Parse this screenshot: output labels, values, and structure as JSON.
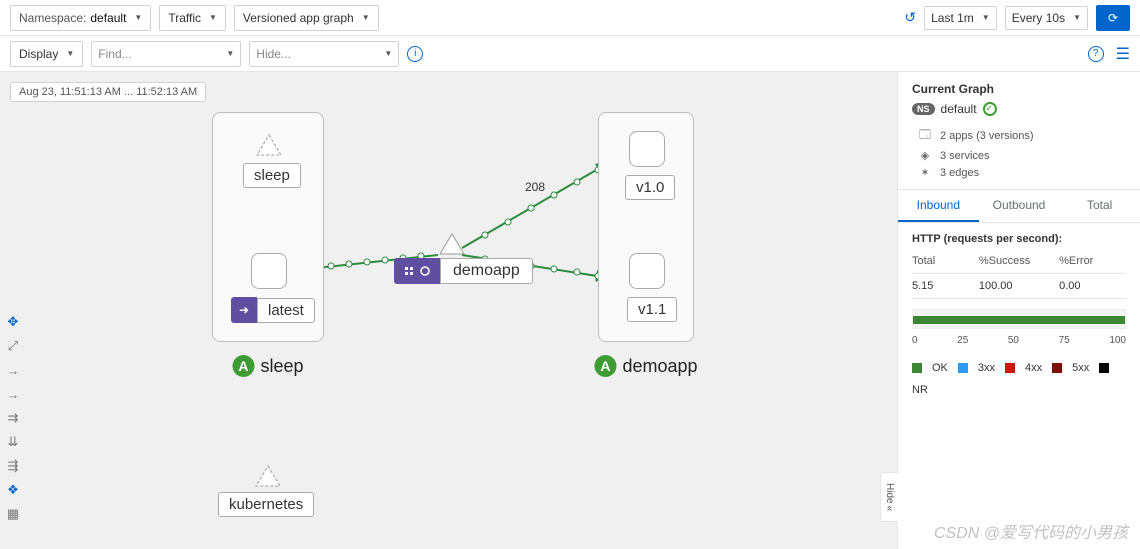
{
  "toolbar1": {
    "namespace_label": "Namespace:",
    "namespace_value": "default",
    "traffic": "Traffic",
    "graph_type": "Versioned app graph",
    "time_range": "Last 1m",
    "refresh_interval": "Every 10s"
  },
  "toolbar2": {
    "display": "Display",
    "find_placeholder": "Find...",
    "hide_placeholder": "Hide..."
  },
  "canvas": {
    "timestamp": "Aug 23, 11:51:13 AM ... 11:52:13 AM",
    "apps": {
      "sleep": "sleep",
      "demoapp": "demoapp"
    },
    "workloads": {
      "latest": "latest",
      "v10": "v1.0",
      "v11": "v1.1"
    },
    "services": {
      "demoapp": "demoapp",
      "kubernetes": "kubernetes",
      "sleep": "sleep"
    },
    "edge_rate": "208"
  },
  "sidebar": {
    "title": "Current Graph",
    "ns_badge": "NS",
    "ns_name": "default",
    "summary": {
      "apps": "2 apps (3 versions)",
      "services": "3 services",
      "edges": "3 edges"
    },
    "tabs": {
      "inbound": "Inbound",
      "outbound": "Outbound",
      "total": "Total"
    },
    "metric_title": "HTTP (requests per second):",
    "columns": {
      "total": "Total",
      "success": "%Success",
      "error": "%Error"
    },
    "row": {
      "total": "5.15",
      "success": "100.00",
      "error": "0.00"
    },
    "axis": [
      "0",
      "25",
      "50",
      "75",
      "100"
    ],
    "legend": {
      "ok": "OK",
      "3xx": "3xx",
      "4xx": "4xx",
      "5xx": "5xx",
      "nr": "NR"
    },
    "hide": "Hide"
  },
  "watermark": "CSDN @爱写代码的小男孩"
}
